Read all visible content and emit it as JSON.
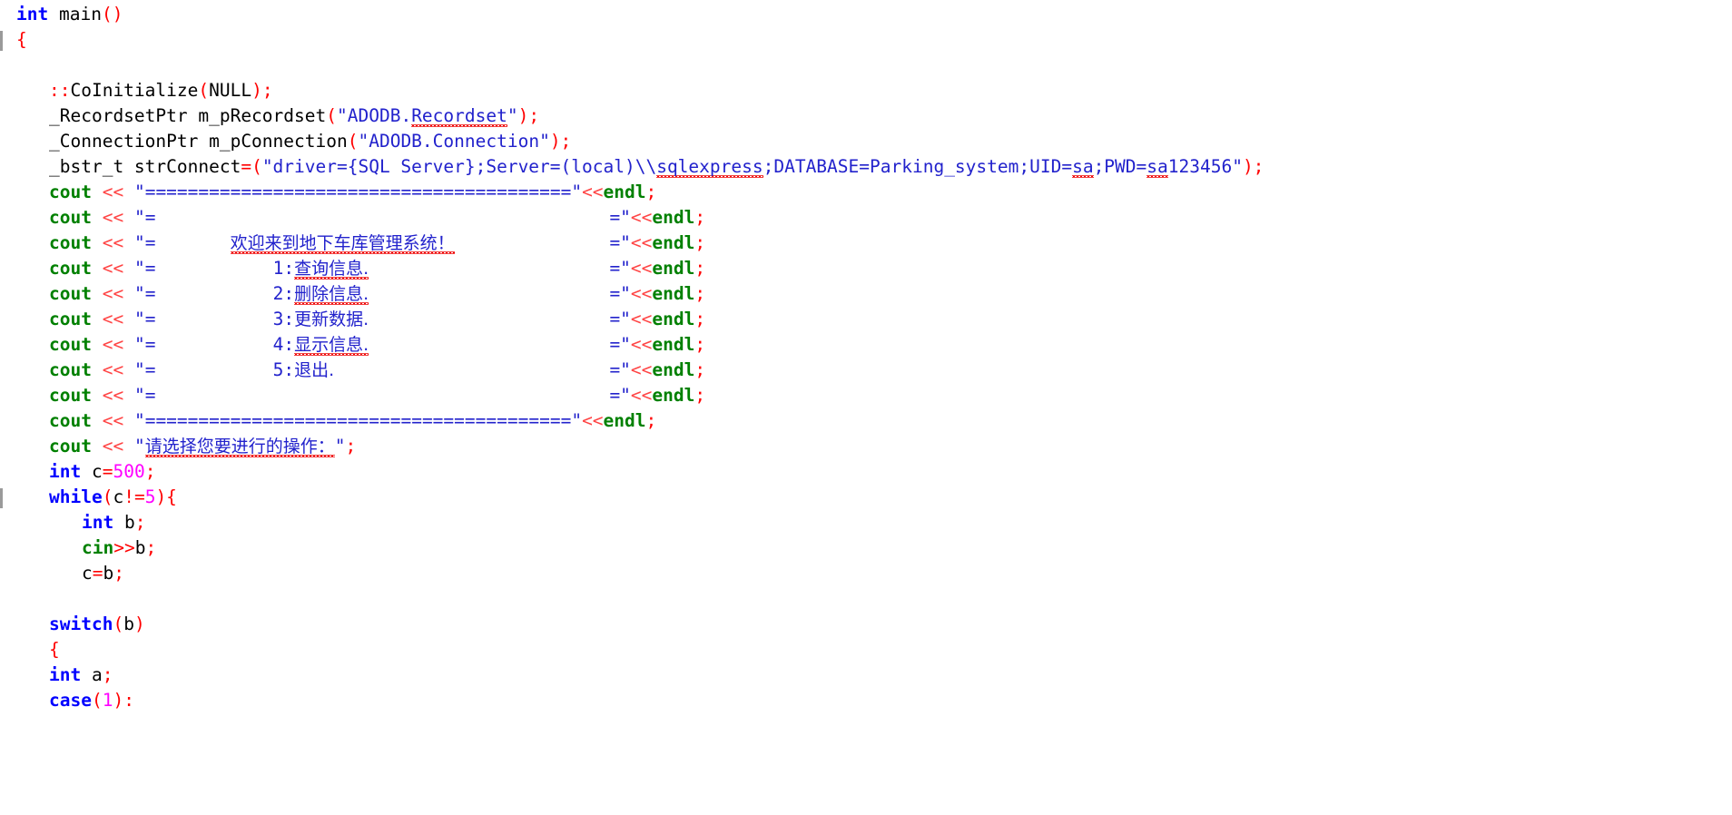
{
  "editor": {
    "language": "C++",
    "colors": {
      "keyword": "#0000ff",
      "string": "#2222cc",
      "punctuation": "#ff0000",
      "number": "#ff00ff",
      "stream_object": "#008000",
      "plain_text": "#000000",
      "background": "#ffffff",
      "spellcheck_underline": "#ee0000",
      "change_bar": "#9a9a9a"
    },
    "separator_bar": "========================================",
    "menu_pad_close": "="
  },
  "code": {
    "lines": [
      {
        "n": 1,
        "indent": 0,
        "changebar": false,
        "tokens": [
          {
            "t": "kw",
            "v": "int"
          },
          {
            "t": "plain",
            "v": " "
          },
          {
            "t": "id",
            "v": "main"
          },
          {
            "t": "punct",
            "v": "()"
          }
        ]
      },
      {
        "n": 2,
        "indent": 0,
        "changebar": true,
        "tokens": [
          {
            "t": "brace",
            "v": "{"
          }
        ]
      },
      {
        "n": 3,
        "indent": 0,
        "changebar": false,
        "tokens": []
      },
      {
        "n": 4,
        "indent": 1,
        "changebar": false,
        "tokens": [
          {
            "t": "punct",
            "v": "::"
          },
          {
            "t": "id",
            "v": "CoInitialize"
          },
          {
            "t": "punct",
            "v": "("
          },
          {
            "t": "id",
            "v": "NULL"
          },
          {
            "t": "punct",
            "v": ");"
          }
        ]
      },
      {
        "n": 5,
        "indent": 1,
        "changebar": false,
        "tokens": [
          {
            "t": "id",
            "v": "_RecordsetPtr m_pRecordset"
          },
          {
            "t": "punct",
            "v": "("
          },
          {
            "t": "str",
            "v": "\"ADODB."
          },
          {
            "t": "str squig",
            "v": "Recordset"
          },
          {
            "t": "str",
            "v": "\""
          },
          {
            "t": "punct",
            "v": ");"
          }
        ]
      },
      {
        "n": 6,
        "indent": 1,
        "changebar": false,
        "tokens": [
          {
            "t": "id",
            "v": "_ConnectionPtr m_pConnection"
          },
          {
            "t": "punct",
            "v": "("
          },
          {
            "t": "str",
            "v": "\"ADODB.Connection\""
          },
          {
            "t": "punct",
            "v": ");"
          }
        ]
      },
      {
        "n": 7,
        "indent": 1,
        "changebar": false,
        "tokens": [
          {
            "t": "id",
            "v": "_bstr_t strConnect"
          },
          {
            "t": "punct",
            "v": "=("
          },
          {
            "t": "str",
            "v": "\"driver={SQL Server};Server=(local)\\\\"
          },
          {
            "t": "str squig",
            "v": "sqlexpress"
          },
          {
            "t": "str",
            "v": ";DATABASE=Parking_system;UID="
          },
          {
            "t": "str squig",
            "v": "sa"
          },
          {
            "t": "str",
            "v": ";PWD="
          },
          {
            "t": "str squig",
            "v": "sa"
          },
          {
            "t": "str",
            "v": "123456\""
          },
          {
            "t": "punct",
            "v": ");"
          }
        ]
      },
      {
        "n": 8,
        "indent": 1,
        "changebar": false,
        "kind": "cout_sep",
        "text_left": "\"",
        "text_sep": "========================================",
        "text_right": "\""
      },
      {
        "n": 9,
        "indent": 1,
        "changebar": false,
        "kind": "cout_row",
        "inner": "",
        "cjk": ""
      },
      {
        "n": 10,
        "indent": 1,
        "changebar": false,
        "kind": "cout_row",
        "inner": "       ",
        "cjk": "欢迎来到地下车库管理系统！",
        "squig": true
      },
      {
        "n": 11,
        "indent": 1,
        "changebar": false,
        "kind": "cout_row",
        "inner": "           1:",
        "cjk": "查询信息.",
        "squig": true
      },
      {
        "n": 12,
        "indent": 1,
        "changebar": false,
        "kind": "cout_row",
        "inner": "           2:",
        "cjk": "删除信息.",
        "squig": true
      },
      {
        "n": 13,
        "indent": 1,
        "changebar": false,
        "kind": "cout_row",
        "inner": "           3:",
        "cjk": "更新数据.",
        "squig": false
      },
      {
        "n": 14,
        "indent": 1,
        "changebar": false,
        "kind": "cout_row",
        "inner": "           4:",
        "cjk": "显示信息.",
        "squig": true
      },
      {
        "n": 15,
        "indent": 1,
        "changebar": false,
        "kind": "cout_row",
        "inner": "           5:",
        "cjk": "退出.",
        "squig": false
      },
      {
        "n": 16,
        "indent": 1,
        "changebar": false,
        "kind": "cout_row",
        "inner": "",
        "cjk": ""
      },
      {
        "n": 17,
        "indent": 1,
        "changebar": false,
        "kind": "cout_sep",
        "text_left": "\"",
        "text_sep": "========================================",
        "text_right": "\""
      },
      {
        "n": 18,
        "indent": 1,
        "changebar": false,
        "kind": "cout_prompt",
        "cjk": "请选择您要进行的操作："
      },
      {
        "n": 19,
        "indent": 1,
        "changebar": false,
        "tokens": [
          {
            "t": "kw",
            "v": "int"
          },
          {
            "t": "plain",
            "v": " "
          },
          {
            "t": "id",
            "v": "c"
          },
          {
            "t": "punct",
            "v": "="
          },
          {
            "t": "num",
            "v": "500"
          },
          {
            "t": "punct",
            "v": ";"
          }
        ]
      },
      {
        "n": 20,
        "indent": 1,
        "changebar": true,
        "tokens": [
          {
            "t": "kw",
            "v": "while"
          },
          {
            "t": "punct",
            "v": "("
          },
          {
            "t": "id",
            "v": "c"
          },
          {
            "t": "punct",
            "v": "!="
          },
          {
            "t": "num",
            "v": "5"
          },
          {
            "t": "punct",
            "v": "){"
          }
        ]
      },
      {
        "n": 21,
        "indent": 2,
        "changebar": false,
        "tokens": [
          {
            "t": "kw",
            "v": "int"
          },
          {
            "t": "plain",
            "v": " "
          },
          {
            "t": "id",
            "v": "b"
          },
          {
            "t": "punct",
            "v": ";"
          }
        ]
      },
      {
        "n": 22,
        "indent": 2,
        "changebar": false,
        "tokens": [
          {
            "t": "iostream",
            "v": "cin"
          },
          {
            "t": "punct",
            "v": ">>"
          },
          {
            "t": "id",
            "v": "b"
          },
          {
            "t": "punct",
            "v": ";"
          }
        ]
      },
      {
        "n": 23,
        "indent": 2,
        "changebar": false,
        "tokens": [
          {
            "t": "id",
            "v": "c"
          },
          {
            "t": "punct",
            "v": "="
          },
          {
            "t": "id",
            "v": "b"
          },
          {
            "t": "punct",
            "v": ";"
          }
        ]
      },
      {
        "n": 24,
        "indent": 0,
        "changebar": false,
        "tokens": []
      },
      {
        "n": 25,
        "indent": 1,
        "changebar": false,
        "tokens": [
          {
            "t": "kw",
            "v": "switch"
          },
          {
            "t": "punct",
            "v": "("
          },
          {
            "t": "id",
            "v": "b"
          },
          {
            "t": "punct",
            "v": ")"
          }
        ]
      },
      {
        "n": 26,
        "indent": 1,
        "changebar": false,
        "tokens": [
          {
            "t": "brace",
            "v": "{"
          }
        ]
      },
      {
        "n": 27,
        "indent": 1,
        "changebar": false,
        "tokens": [
          {
            "t": "kw",
            "v": "int"
          },
          {
            "t": "plain",
            "v": " "
          },
          {
            "t": "id",
            "v": "a"
          },
          {
            "t": "punct",
            "v": ";"
          }
        ]
      },
      {
        "n": 28,
        "indent": 1,
        "changebar": false,
        "clipped": true,
        "tokens": [
          {
            "t": "kw",
            "v": "case"
          },
          {
            "t": "punct",
            "v": "("
          },
          {
            "t": "num",
            "v": "1"
          },
          {
            "t": "punct",
            "v": "):"
          }
        ]
      }
    ]
  }
}
